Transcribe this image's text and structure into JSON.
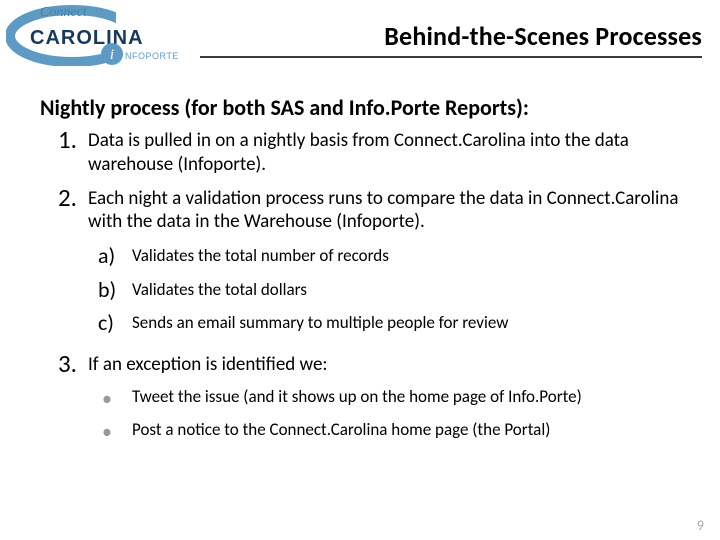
{
  "header": {
    "title": "Behind-the-Scenes Processes",
    "logo": {
      "word_top": "Connect",
      "word_main": "CAROLINA",
      "badge_letter": "i",
      "badge_text": "NFOPORTE"
    }
  },
  "content": {
    "intro": "Nightly process (for both SAS and Info.Porte Reports):",
    "items": [
      {
        "marker": "1.",
        "text": "Data is pulled in on a nightly basis from Connect.Carolina into the data warehouse (Infoporte)."
      },
      {
        "marker": "2.",
        "text": "Each night a validation process runs to compare the data in Connect.Carolina with the data in the Warehouse (Infoporte).",
        "sub_alpha": [
          {
            "marker": "a)",
            "text": "Validates the total number of records"
          },
          {
            "marker": "b)",
            "text": "Validates the total dollars"
          },
          {
            "marker": "c)",
            "text": "Sends an email summary to multiple people for review"
          }
        ]
      },
      {
        "marker": "3.",
        "text": "If an exception is identified we:",
        "sub_bullet": [
          {
            "text": "Tweet the issue (and it shows up on the home page of Info.Porte)"
          },
          {
            "text": "Post a notice to the Connect.Carolina home page (the Portal)"
          }
        ]
      }
    ]
  },
  "page_number": "9"
}
